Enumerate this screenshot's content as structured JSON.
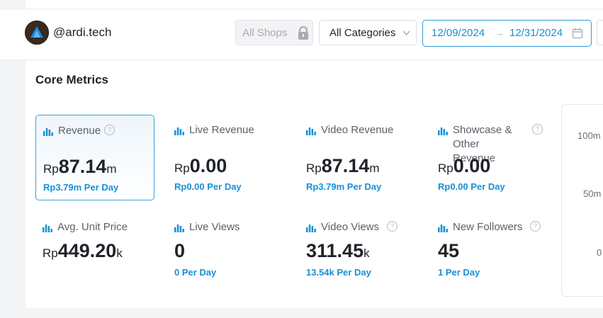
{
  "header": {
    "username": "@ardi.tech",
    "shop_select": {
      "label": "All Shops",
      "icon": "lock-icon"
    },
    "category_select": {
      "label": "All Categories",
      "icon": "chevron-down-icon"
    },
    "date_range": {
      "start": "12/09/2024",
      "separator": "→",
      "end": "12/31/2024",
      "icon": "calendar-icon"
    }
  },
  "main": {
    "title": "Core Metrics",
    "metrics": [
      {
        "label": "Revenue",
        "help": "?",
        "currency": "Rp",
        "value": "87.14",
        "unit": "m",
        "per_day": "Rp3.79m Per Day",
        "selected": true
      },
      {
        "label": "Live Revenue",
        "currency": "Rp",
        "value": "0.00",
        "unit": "",
        "per_day": "Rp0.00 Per Day"
      },
      {
        "label": "Video Revenue",
        "currency": "Rp",
        "value": "87.14",
        "unit": "m",
        "per_day": "Rp3.79m Per Day"
      },
      {
        "label": "Showcase & Other Revenue",
        "help": "?",
        "currency": "Rp",
        "value": "0.00",
        "unit": "",
        "per_day": "Rp0.00 Per Day"
      },
      {
        "label": "Avg. Unit Price",
        "currency": "Rp",
        "value": "449.20",
        "unit": "k",
        "per_day": ""
      },
      {
        "label": "Live Views",
        "currency": "",
        "value": "0",
        "unit": "",
        "per_day": "0 Per Day"
      },
      {
        "label": "Video Views",
        "help": "?",
        "currency": "",
        "value": "311.45",
        "unit": "k",
        "per_day": "13.54k Per Day"
      },
      {
        "label": "New Followers",
        "help": "?",
        "currency": "",
        "value": "45",
        "unit": "",
        "per_day": "1 Per Day"
      }
    ],
    "chart": {
      "y_ticks": [
        "100m",
        "50m",
        "0"
      ]
    }
  },
  "colors": {
    "accent": "#1890d8",
    "border_selected": "#3aa0dc",
    "text": "#1f2329",
    "muted": "#5b6068"
  }
}
